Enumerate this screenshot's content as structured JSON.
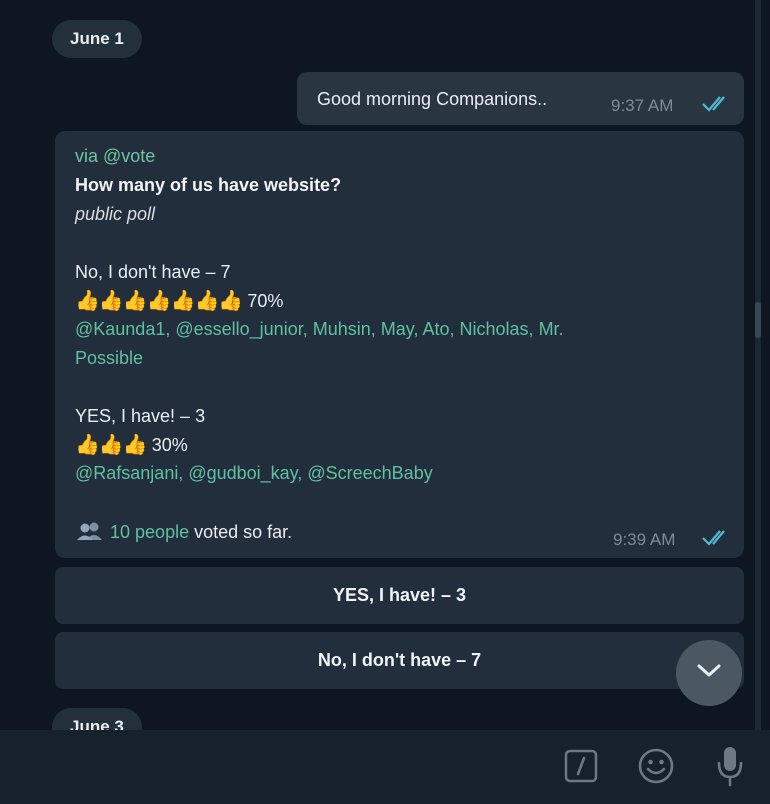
{
  "dates": {
    "top": "June 1",
    "next": "June 3"
  },
  "outgoing": {
    "text": "Good morning Companions..",
    "time": "9:37 AM"
  },
  "poll": {
    "via": "via @vote",
    "question": "How many of us have website?",
    "type": "public poll",
    "option1": {
      "label": "No, I don't have – 7",
      "emoji": "👍👍👍👍👍👍👍",
      "percent": "70%",
      "voters": [
        "@Kaunda1",
        "@essello_junior",
        "Muhsin",
        "May",
        "Ato",
        "Nicholas",
        "Mr."
      ],
      "voters_line2": "Possible"
    },
    "option2": {
      "label": "YES, I have! – 3",
      "emoji": "👍👍👍",
      "percent": "30%",
      "voters": [
        "@Rafsanjani",
        "@gudboi_kay",
        "@ScreechBaby"
      ]
    },
    "footer": {
      "people_link": "10 people",
      "rest": "voted so far."
    },
    "time": "9:39 AM"
  },
  "buttons": {
    "yes": "YES, I have! – 3",
    "no": "No, I don't have – 7"
  },
  "icons": [
    "double-check-icon",
    "people-icon",
    "chevron-down-icon",
    "command-icon",
    "emoji-icon",
    "microphone-icon"
  ]
}
